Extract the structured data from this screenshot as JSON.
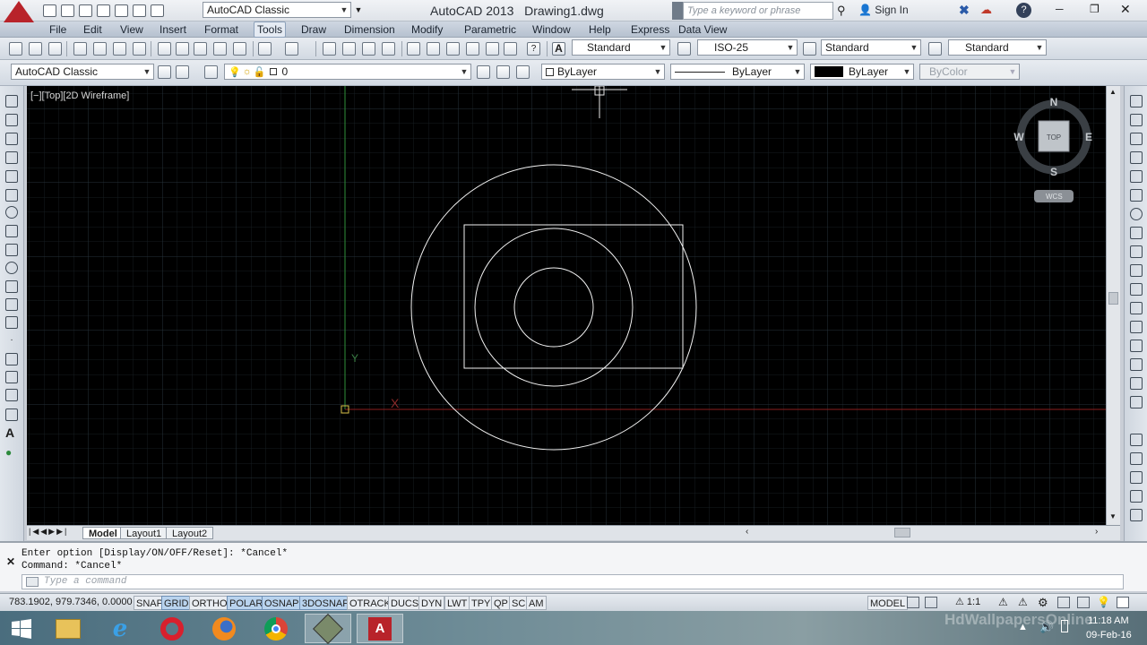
{
  "title_bar": {
    "workspace": "AutoCAD Classic",
    "app_title": "AutoCAD 2013",
    "file_name": "Drawing1.dwg",
    "search_placeholder": "Type a keyword or phrase",
    "sign_in": "Sign In",
    "help": "?",
    "minimize": "─",
    "restore": "❐",
    "close": "✕"
  },
  "menu": [
    "File",
    "Edit",
    "View",
    "Insert",
    "Format",
    "Tools",
    "Draw",
    "Dimension",
    "Modify",
    "Parametric",
    "Window",
    "Help",
    "Express",
    "Data View"
  ],
  "menu_active": "Tools",
  "styles": {
    "text_style": "Standard",
    "dim_style": "ISO-25",
    "table_style": "Standard",
    "multileader_style": "Standard"
  },
  "layers": {
    "workspace": "AutoCAD Classic",
    "current_layer": "0",
    "color": "ByLayer",
    "linetype": "ByLayer",
    "lineweight": "ByLayer",
    "plot_style": "ByColor"
  },
  "viewport": {
    "label": "[−][Top][2D Wireframe]",
    "compass": {
      "n": "N",
      "s": "S",
      "e": "E",
      "w": "W",
      "top": "TOP"
    },
    "wcs": "WCS",
    "ucs_x": "X",
    "ucs_y": "Y",
    "grid_color": "#1f2a2f",
    "entity_color": "#ffffff"
  },
  "tabs": {
    "model": "Model",
    "layout1": "Layout1",
    "layout2": "Layout2"
  },
  "command": {
    "line1": "Enter option [Display/ON/OFF/Reset]: *Cancel*",
    "line2": "Command: *Cancel*",
    "placeholder": "Type a command"
  },
  "status": {
    "coords": "783.1902, 979.7346, 0.0000",
    "toggles": [
      {
        "label": "SNAP",
        "on": false
      },
      {
        "label": "GRID",
        "on": true
      },
      {
        "label": "ORTHO",
        "on": false
      },
      {
        "label": "POLAR",
        "on": true
      },
      {
        "label": "OSNAP",
        "on": true
      },
      {
        "label": "3DOSNAP",
        "on": true
      },
      {
        "label": "OTRACK",
        "on": false
      },
      {
        "label": "DUCS",
        "on": false
      },
      {
        "label": "DYN",
        "on": false
      },
      {
        "label": "LWT",
        "on": false
      },
      {
        "label": "TPY",
        "on": false
      },
      {
        "label": "QP",
        "on": false
      },
      {
        "label": "SC",
        "on": false
      },
      {
        "label": "AM",
        "on": false
      }
    ],
    "model": "MODEL",
    "scale": "1:1"
  },
  "taskbar": {
    "time": "11:18 AM",
    "date": "09-Feb-16",
    "watermark": "HdWallpapersOnline"
  }
}
